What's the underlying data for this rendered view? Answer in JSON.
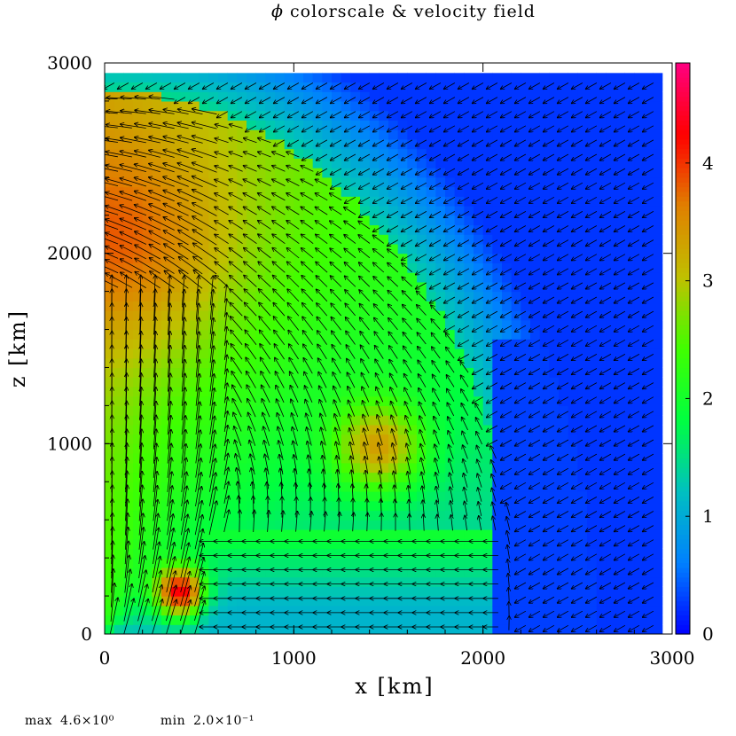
{
  "title_symbol": "ϕ",
  "title_text": "colorscale & velocity field",
  "chart_data": {
    "type": "heatmap",
    "title": "ϕ colorscale & velocity field",
    "xlabel": "x [km]",
    "ylabel": "z [km]",
    "xlim": [
      0,
      3000
    ],
    "ylim": [
      0,
      3000
    ],
    "x_ticks": [
      "0",
      "1000",
      "2000",
      "3000"
    ],
    "y_ticks": [
      "0",
      "1000",
      "2000",
      "3000"
    ],
    "colorbar": {
      "range": [
        0,
        4.85
      ],
      "ticks": [
        "0",
        "1",
        "2",
        "3",
        "4"
      ],
      "colormap": [
        "#0000ff",
        "#0080ff",
        "#00c0c0",
        "#00ff40",
        "#40ff00",
        "#c0c000",
        "#e08000",
        "#ff0000",
        "#ff0080"
      ]
    },
    "field": "phi",
    "overlay": "velocity vectors",
    "max": "4.6×10⁰",
    "min": "2.0×10⁻¹"
  },
  "footer": {
    "max_label": "max",
    "max_value": "4.6×10⁰",
    "min_label": "min",
    "min_value": "2.0×10⁻¹"
  }
}
